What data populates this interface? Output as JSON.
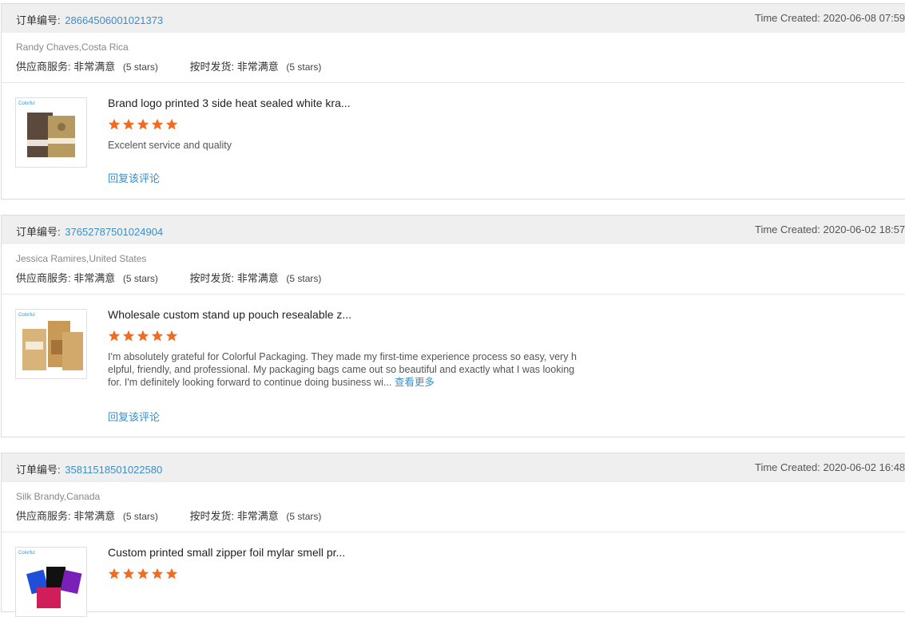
{
  "labels": {
    "order_prefix": "订单编号:",
    "time_prefix": "Time Created:",
    "supplier_service": "供应商服务:",
    "on_time_delivery": "按时发货:",
    "reply": "回复该评论",
    "see_more": "查看更多"
  },
  "colors": {
    "link": "#3b8ec9",
    "star": "#f36b21",
    "header_bg": "#efefef"
  },
  "reviews": [
    {
      "order_no": "28664506001021373",
      "time_created": "2020-06-08 07:59",
      "buyer": "Randy Chaves,Costa Rica",
      "supplier_value": "非常满意",
      "supplier_stars": "(5 stars)",
      "delivery_value": "非常满意",
      "delivery_stars": "(5 stars)",
      "product_name": "Brand logo printed 3 side heat sealed white kra...",
      "product_icon": "kraft-pouch-thumbnail",
      "rating": 5,
      "comment": "Excelent service and quality"
    },
    {
      "order_no": "37652787501024904",
      "time_created": "2020-06-02 18:57",
      "buyer": "Jessica Ramires,United States",
      "supplier_value": "非常满意",
      "supplier_stars": "(5 stars)",
      "delivery_value": "非常满意",
      "delivery_stars": "(5 stars)",
      "product_name": "Wholesale custom stand up pouch resealable z...",
      "product_icon": "stand-up-pouch-thumbnail",
      "rating": 5,
      "comment": "I'm absolutely grateful for Colorful Packaging. They made my first-time experience process so easy, very helpful, friendly, and professional. My packaging bags came out so beautiful and exactly what I was looking for. I'm definitely looking forward to continue doing business wi..."
    },
    {
      "order_no": "35811518501022580",
      "time_created": "2020-06-02 16:48",
      "buyer": "Silk Brandy,Canada",
      "supplier_value": "非常满意",
      "supplier_stars": "(5 stars)",
      "delivery_value": "非常满意",
      "delivery_stars": "(5 stars)",
      "product_name": "Custom printed small zipper foil mylar smell pr...",
      "product_icon": "mylar-bags-thumbnail",
      "rating": 5,
      "comment": ""
    }
  ]
}
